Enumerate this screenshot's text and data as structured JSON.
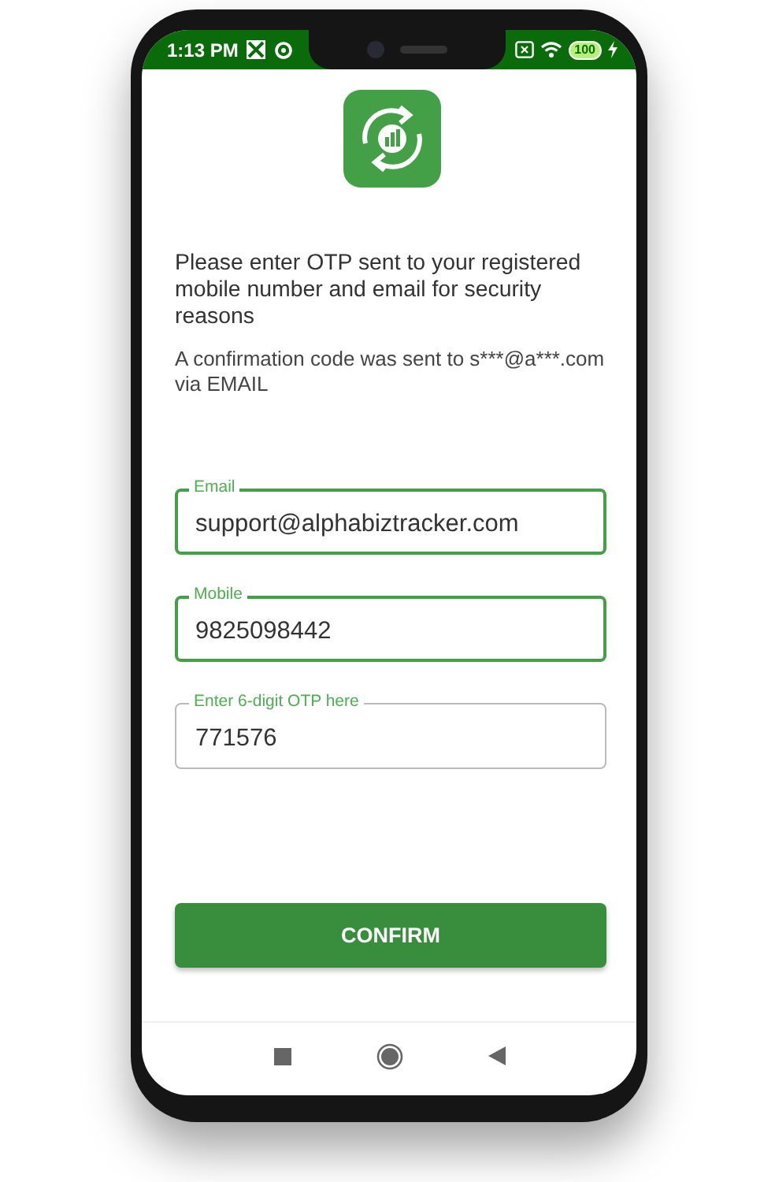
{
  "status_bar": {
    "time": "1:13 PM",
    "battery": "100"
  },
  "instructions": "Please enter OTP sent to your registered mobile number and email for security reasons",
  "confirmation_note": "A confirmation code was sent to s***@a***.com via EMAIL",
  "fields": [
    {
      "label": "Email",
      "value": "support@alphabiztracker.com",
      "focused": true
    },
    {
      "label": "Mobile",
      "value": "9825098442",
      "focused": true
    },
    {
      "label": "Enter 6-digit OTP here",
      "value": "771576",
      "focused": false
    }
  ],
  "button": "CONFIRM"
}
